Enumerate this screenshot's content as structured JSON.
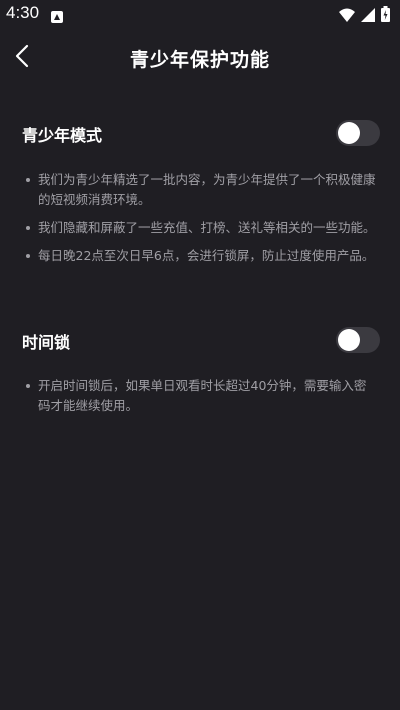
{
  "status_bar": {
    "time": "4:30",
    "icons": [
      "app-notification-icon",
      "wifi-icon",
      "signal-icon",
      "battery-icon"
    ]
  },
  "header": {
    "back_icon": "chevron-left-icon",
    "title": "青少年保护功能"
  },
  "youth_mode": {
    "title": "青少年模式",
    "enabled": false,
    "bullets": [
      "我们为青少年精选了一批内容，为青少年提供了一个积极健康的短视频消费环境。",
      "我们隐藏和屏蔽了一些充值、打榜、送礼等相关的一些功能。",
      "每日晚22点至次日早6点，会进行锁屏，防止过度使用产品。"
    ]
  },
  "time_lock": {
    "title": "时间锁",
    "enabled": false,
    "bullets": [
      "开启时间锁后，如果单日观看时长超过40分钟，需要输入密码才能继续使用。"
    ]
  },
  "colors": {
    "background": "#1f1e23",
    "text_primary": "#ffffff",
    "text_secondary": "#a09fa5",
    "toggle_track": "#3b3a40"
  }
}
